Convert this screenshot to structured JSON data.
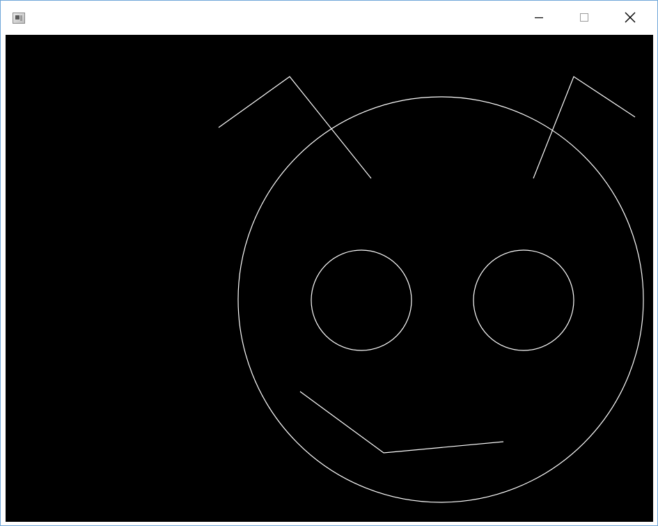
{
  "window": {
    "title": "",
    "app_icon": "app-window-icon",
    "controls": [
      {
        "name": "minimize-button",
        "icon": "minimize-icon"
      },
      {
        "name": "maximize-button",
        "icon": "maximize-icon"
      },
      {
        "name": "close-button",
        "icon": "close-icon"
      }
    ]
  },
  "canvas": {
    "background_color": "#000000",
    "stroke_color": "#ffffff",
    "drawing": "smiley-face-with-antennae"
  },
  "colors": {
    "window_border": "#6fa6d8",
    "titlebar": "#ffffff"
  }
}
